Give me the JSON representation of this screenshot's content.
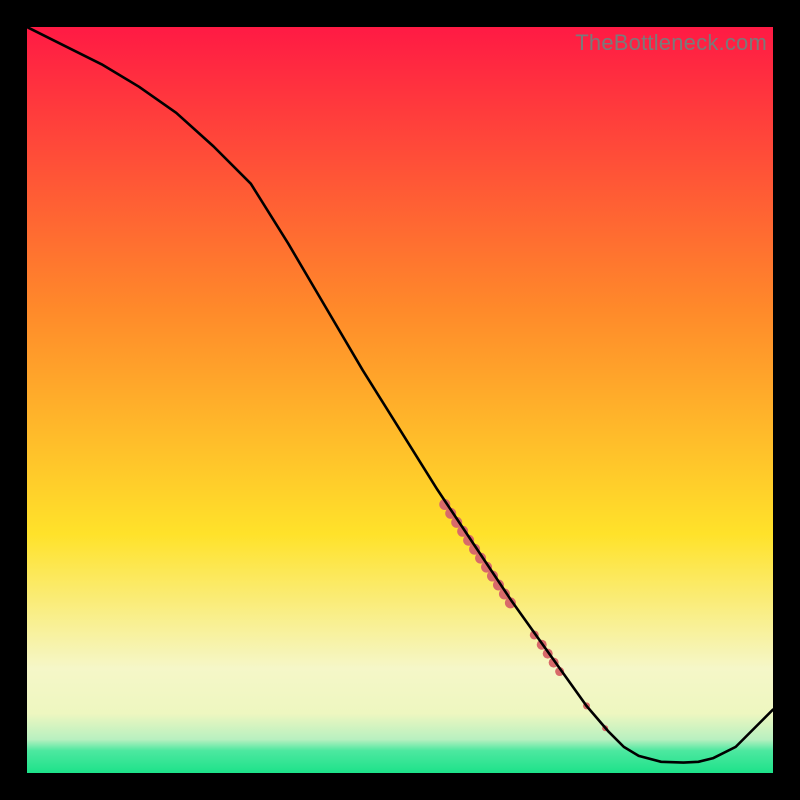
{
  "watermark": "TheBottleneck.com",
  "colors": {
    "black": "#000000",
    "line": "#000000",
    "marker": "#d86a6a",
    "grad_top": "#ff1a44",
    "grad_mid1": "#ff8a2a",
    "grad_mid2": "#ffe22a",
    "grad_pale": "#f5f7c8",
    "grad_green": "#1de28a"
  },
  "chart_data": {
    "type": "line",
    "title": "",
    "xlabel": "",
    "ylabel": "",
    "xlim": [
      0,
      100
    ],
    "ylim": [
      0,
      100
    ],
    "series": [
      {
        "name": "curve",
        "x": [
          0,
          5,
          10,
          15,
          20,
          25,
          30,
          35,
          40,
          45,
          50,
          55,
          60,
          65,
          70,
          75,
          78,
          80,
          82,
          85,
          88,
          90,
          92,
          95,
          100
        ],
        "y": [
          100,
          97.5,
          95,
          92,
          88.5,
          84,
          79,
          71,
          62.5,
          54,
          46,
          38,
          30.5,
          23,
          16,
          9,
          5.5,
          3.5,
          2.3,
          1.5,
          1.4,
          1.5,
          2.0,
          3.5,
          8.5
        ]
      }
    ],
    "markers": [
      {
        "x": 56.0,
        "y": 36.0,
        "r": 5.5
      },
      {
        "x": 56.8,
        "y": 34.8,
        "r": 5.5
      },
      {
        "x": 57.6,
        "y": 33.6,
        "r": 5.5
      },
      {
        "x": 58.4,
        "y": 32.4,
        "r": 5.5
      },
      {
        "x": 59.2,
        "y": 31.2,
        "r": 5.5
      },
      {
        "x": 60.0,
        "y": 30.0,
        "r": 5.5
      },
      {
        "x": 60.8,
        "y": 28.8,
        "r": 5.5
      },
      {
        "x": 61.6,
        "y": 27.6,
        "r": 5.5
      },
      {
        "x": 62.4,
        "y": 26.4,
        "r": 5.5
      },
      {
        "x": 63.2,
        "y": 25.2,
        "r": 5.5
      },
      {
        "x": 64.0,
        "y": 24.0,
        "r": 5.5
      },
      {
        "x": 64.8,
        "y": 22.8,
        "r": 5.5
      },
      {
        "x": 68.0,
        "y": 18.5,
        "r": 4.5
      },
      {
        "x": 69.0,
        "y": 17.2,
        "r": 5.0
      },
      {
        "x": 69.8,
        "y": 16.0,
        "r": 5.0
      },
      {
        "x": 70.6,
        "y": 14.8,
        "r": 5.0
      },
      {
        "x": 71.4,
        "y": 13.6,
        "r": 4.5
      },
      {
        "x": 75.0,
        "y": 9.0,
        "r": 3.5
      },
      {
        "x": 77.5,
        "y": 6.0,
        "r": 3.0
      }
    ]
  }
}
